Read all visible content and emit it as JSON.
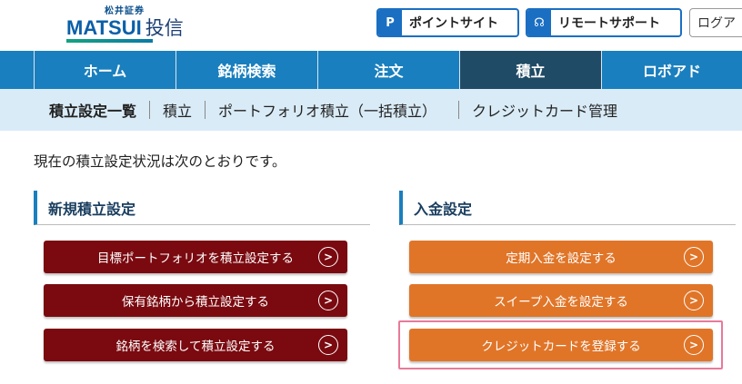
{
  "header": {
    "logo_small": "松井証券",
    "logo_main": "MATSUI",
    "logo_jp": "投信",
    "buttons": [
      {
        "icon": "P",
        "label": "ポイントサイト"
      },
      {
        "icon": "☊",
        "label": "リモートサポート"
      },
      {
        "label": "ログア"
      }
    ]
  },
  "nav": {
    "items": [
      "ホーム",
      "銘柄検索",
      "注文",
      "積立",
      "ロボアド"
    ],
    "active_index": 3
  },
  "subnav": {
    "items": [
      "積立設定一覧",
      "積立",
      "ポートフォリオ積立（一括積立）",
      "クレジットカード管理"
    ]
  },
  "intro": "現在の積立設定状況は次のとおりです。",
  "sections": {
    "new": {
      "title": "新規積立設定",
      "buttons": [
        "目標ポートフォリオを積立設定する",
        "保有銘柄から積立設定する",
        "銘柄を検索して積立設定する"
      ]
    },
    "deposit": {
      "title": "入金設定",
      "buttons": [
        "定期入金を設定する",
        "スイープ入金を設定する",
        "クレジットカードを登録する"
      ]
    }
  },
  "colors": {
    "nav_blue": "#1a7fbe",
    "nav_active": "#204b66",
    "red_button": "#7a0a10",
    "orange_button": "#e07528",
    "highlight": "#e87a9a"
  }
}
